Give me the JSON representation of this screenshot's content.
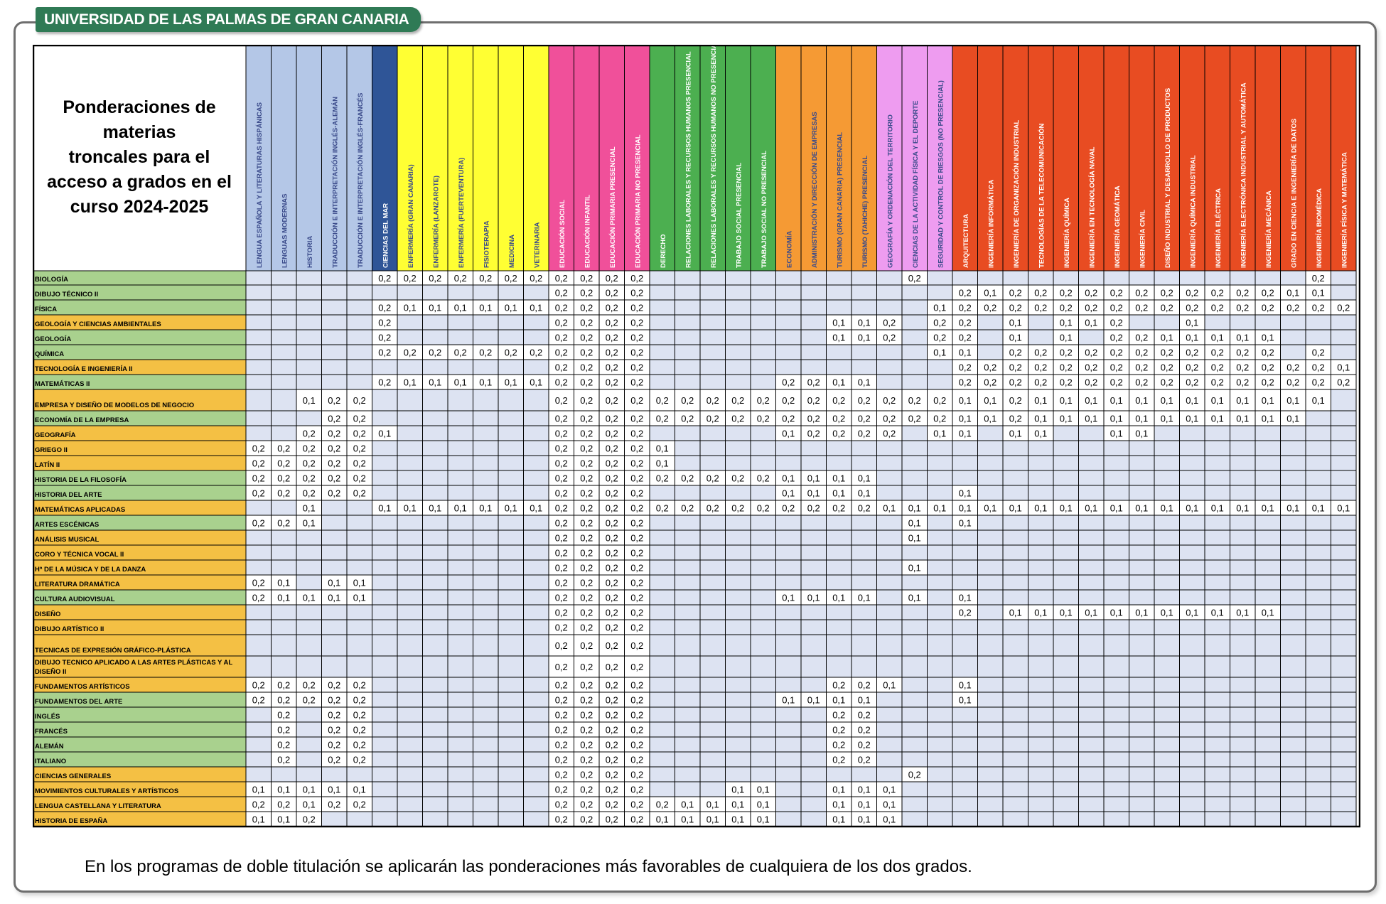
{
  "header": {
    "banner": "UNIVERSIDAD DE LAS PALMAS DE GRAN CANARIA",
    "title_lines": [
      "Ponderaciones de",
      "materias",
      "troncales para el",
      "acceso a grados en el",
      "curso 2024-2025"
    ]
  },
  "footnote": "En los programas de doble titulación se aplicarán las ponderaciones más favorables de cualquiera de los dos grados.",
  "colors": {
    "banner": "#2f7a55",
    "row_green": "#a9d18e",
    "row_orange": "#f4c044",
    "cell_empty": "#dde3f2",
    "cell_filled": "#ffffff",
    "col_blue_light": "#b4c7e7",
    "col_blue_dark": "#2f5597",
    "col_yellow": "#ffff33",
    "col_pink": "#f0509a",
    "col_green": "#4caf50",
    "col_orange": "#f59a34",
    "col_violet": "#ee9cf0",
    "col_red": "#e84c22"
  },
  "degrees": [
    {
      "name": "LENGUA ESPAÑOLA Y LITERATURAS HISPÁNICAS",
      "group": "blue_light"
    },
    {
      "name": "LENGUAS MODERNAS",
      "group": "blue_light"
    },
    {
      "name": "HISTORIA",
      "group": "blue_light"
    },
    {
      "name": "TRADUCCIÓN E INTERPRETACIÓN INGLÉS-ALEMÁN",
      "group": "blue_light"
    },
    {
      "name": "TRADUCCIÓN E INTERPRETACIÓN INGLÉS-FRANCÉS",
      "group": "blue_light"
    },
    {
      "name": "CIENCIAS DEL MAR",
      "group": "blue_dark"
    },
    {
      "name": "ENFERMERÍA (GRAN CANARIA)",
      "group": "yellow"
    },
    {
      "name": "ENFERMERÍA (LANZAROTE)",
      "group": "yellow"
    },
    {
      "name": "ENFERMERÍA (FUERTEVENTURA)",
      "group": "yellow"
    },
    {
      "name": "FISIOTERAPIA",
      "group": "yellow"
    },
    {
      "name": "MEDICINA",
      "group": "yellow"
    },
    {
      "name": "VETERINARIA",
      "group": "yellow"
    },
    {
      "name": "EDUCACIÓN SOCIAL",
      "group": "pink"
    },
    {
      "name": "EDUCACIÓN INFANTIL",
      "group": "pink"
    },
    {
      "name": "EDUCACIÓN PRIMARIA PRESENCIAL",
      "group": "pink"
    },
    {
      "name": "EDUCACIÓN PRIMARIA NO PRESENCIAL",
      "group": "pink"
    },
    {
      "name": "DERECHO",
      "group": "green"
    },
    {
      "name": "RELACIONES LABORALES Y RECURSOS HUMANOS PRESENCIAL",
      "group": "green"
    },
    {
      "name": "RELACIONES LABORALES Y RECURSOS HUMANOS NO PRESENCIAL",
      "group": "green"
    },
    {
      "name": "TRABAJO SOCIAL PRESENCIAL",
      "group": "green"
    },
    {
      "name": "TRABAJO SOCIAL NO PRESENCIAL",
      "group": "green"
    },
    {
      "name": "ECONOMÍA",
      "group": "orange"
    },
    {
      "name": "ADMINISTRACIÓN Y DIRECCIÓN DE EMPRESAS",
      "group": "orange"
    },
    {
      "name": "TURISMO (GRAN CANARIA) PRESENCIAL",
      "group": "orange"
    },
    {
      "name": "TURISMO (TAHICHE) PRESENCIAL",
      "group": "orange"
    },
    {
      "name": "GEOGRAFÍA Y ORDENACIÓN DEL TERRITORIO",
      "group": "violet"
    },
    {
      "name": "CIENCIAS DE LA ACTIVIDAD FÍSICA Y EL DEPORTE",
      "group": "violet"
    },
    {
      "name": "SEGURIDAD Y CONTROL DE RIESGOS (NO PRESENCIAL)",
      "group": "violet"
    },
    {
      "name": "ARQUITECTURA",
      "group": "red"
    },
    {
      "name": "INGENIERÍA INFORMÁTICA",
      "group": "red"
    },
    {
      "name": "INGENIERÍA DE ORGANIZACIÓN INDUSTRIAL",
      "group": "red"
    },
    {
      "name": "TECNOLOGÍAS DE LA TELECOMUNICACIÓN",
      "group": "red"
    },
    {
      "name": "INGENIERÍA QUÍMICA",
      "group": "red"
    },
    {
      "name": "INGENIERÍA EN TECNOLOGÍA NAVAL",
      "group": "red"
    },
    {
      "name": "INGENIERÍA GEOMÁTICA",
      "group": "red"
    },
    {
      "name": "INGENIERÍA CIVIL",
      "group": "red"
    },
    {
      "name": "DISEÑO INDUSTRIAL Y DESARROLLO DE PRODUCTOS",
      "group": "red"
    },
    {
      "name": "INGENIERÍA QUÍMICA INDUSTRIAL",
      "group": "red"
    },
    {
      "name": "INGENIERÍA ELÉCTRICA",
      "group": "red"
    },
    {
      "name": "INGENIERÍA ELECTRÓNICA INDUSTRIAL Y AUTOMÁTICA",
      "group": "red"
    },
    {
      "name": "INGENIERÍA MECÁNICA",
      "group": "red"
    },
    {
      "name": "GRADO EN CIENCIA E INGENIERÍA DE DATOS",
      "group": "red"
    },
    {
      "name": "INGENIERÍA BIOMÉDICA",
      "group": "red"
    },
    {
      "name": "INGENIERÍA FÍSICA Y MATEMÁTICA",
      "group": "red"
    }
  ],
  "rows": [
    {
      "subject": "BIOLOGÍA",
      "group": "green",
      "w": {
        "5": "0,2",
        "6": "0,2",
        "7": "0,2",
        "8": "0,2",
        "9": "0,2",
        "10": "0,2",
        "11": "0,2",
        "12": "0,2",
        "13": "0,2",
        "14": "0,2",
        "15": "0,2",
        "26": "0,2",
        "42": "0,2"
      }
    },
    {
      "subject": "DIBUJO TÉCNICO II",
      "group": "green",
      "w": {
        "12": "0,2",
        "13": "0,2",
        "14": "0,2",
        "15": "0,2",
        "28": "0,2",
        "29": "0,1",
        "30": "0,2",
        "31": "0,2",
        "32": "0,2",
        "33": "0,2",
        "34": "0,2",
        "35": "0,2",
        "36": "0,2",
        "37": "0,2",
        "38": "0,2",
        "39": "0,2",
        "40": "0,2",
        "41": "0,1",
        "42": "0,1"
      }
    },
    {
      "subject": "FÍSICA",
      "group": "green",
      "w": {
        "5": "0,2",
        "6": "0,1",
        "7": "0,1",
        "8": "0,1",
        "9": "0,1",
        "10": "0,1",
        "11": "0,1",
        "12": "0,2",
        "13": "0,2",
        "14": "0,2",
        "15": "0,2",
        "27": "0,1",
        "28": "0,2",
        "29": "0,2",
        "30": "0,2",
        "31": "0,2",
        "32": "0,2",
        "33": "0,2",
        "34": "0,2",
        "35": "0,2",
        "36": "0,2",
        "37": "0,2",
        "38": "0,2",
        "39": "0,2",
        "40": "0,2",
        "41": "0,2",
        "42": "0,2",
        "43": "0,2"
      }
    },
    {
      "subject": "GEOLOGÍA Y CIENCIAS AMBIENTALES",
      "group": "orange",
      "w": {
        "5": "0,2",
        "12": "0,2",
        "13": "0,2",
        "14": "0,2",
        "15": "0,2",
        "23": "0,1",
        "24": "0,1",
        "25": "0,2",
        "27": "0,2",
        "28": "0,2",
        "30": "0,1",
        "32": "0,1",
        "33": "0,1",
        "34": "0,2",
        "37": "0,1"
      }
    },
    {
      "subject": "GEOLOGÍA",
      "group": "green",
      "w": {
        "5": "0,2",
        "12": "0,2",
        "13": "0,2",
        "14": "0,2",
        "15": "0,2",
        "23": "0,1",
        "24": "0,1",
        "25": "0,2",
        "27": "0,2",
        "28": "0,2",
        "30": "0,1",
        "32": "0,1",
        "34": "0,2",
        "35": "0,2",
        "36": "0,1",
        "37": "0,1",
        "38": "0,1",
        "39": "0,1",
        "40": "0,1"
      }
    },
    {
      "subject": "QUÍMICA",
      "group": "green",
      "w": {
        "5": "0,2",
        "6": "0,2",
        "7": "0,2",
        "8": "0,2",
        "9": "0,2",
        "10": "0,2",
        "11": "0,2",
        "12": "0,2",
        "13": "0,2",
        "14": "0,2",
        "15": "0,2",
        "27": "0,1",
        "28": "0,1",
        "30": "0,2",
        "31": "0,2",
        "32": "0,2",
        "33": "0,2",
        "34": "0,2",
        "35": "0,2",
        "36": "0,2",
        "37": "0,2",
        "38": "0,2",
        "39": "0,2",
        "40": "0,2",
        "42": "0,2"
      }
    },
    {
      "subject": "TECNOLOGÍA E INGENIERÍA II",
      "group": "orange",
      "w": {
        "12": "0,2",
        "13": "0,2",
        "14": "0,2",
        "15": "0,2",
        "28": "0,2",
        "29": "0,2",
        "30": "0,2",
        "31": "0,2",
        "32": "0,2",
        "33": "0,2",
        "34": "0,2",
        "35": "0,2",
        "36": "0,2",
        "37": "0,2",
        "38": "0,2",
        "39": "0,2",
        "40": "0,2",
        "41": "0,2",
        "42": "0,2",
        "43": "0,1"
      }
    },
    {
      "subject": "MATEMÁTICAS II",
      "group": "green",
      "w": {
        "5": "0,2",
        "6": "0,1",
        "7": "0,1",
        "8": "0,1",
        "9": "0,1",
        "10": "0,1",
        "11": "0,1",
        "12": "0,2",
        "13": "0,2",
        "14": "0,2",
        "15": "0,2",
        "21": "0,2",
        "22": "0,2",
        "23": "0,1",
        "24": "0,1",
        "28": "0,2",
        "29": "0,2",
        "30": "0,2",
        "31": "0,2",
        "32": "0,2",
        "33": "0,2",
        "34": "0,2",
        "35": "0,2",
        "36": "0,2",
        "37": "0,2",
        "38": "0,2",
        "39": "0,2",
        "40": "0,2",
        "41": "0,2",
        "42": "0,2",
        "43": "0,2"
      }
    },
    {
      "subject": "EMPRESA Y DISEÑO DE MODELOS DE NEGOCIO",
      "group": "orange",
      "w": {
        "2": "0,1",
        "3": "0,2",
        "4": "0,2",
        "12": "0,2",
        "13": "0,2",
        "14": "0,2",
        "15": "0,2",
        "16": "0,2",
        "17": "0,2",
        "18": "0,2",
        "19": "0,2",
        "20": "0,2",
        "21": "0,2",
        "22": "0,2",
        "23": "0,2",
        "24": "0,2",
        "25": "0,2",
        "26": "0,2",
        "27": "0,2",
        "28": "0,1",
        "29": "0,1",
        "30": "0,2",
        "31": "0,1",
        "32": "0,1",
        "33": "0,1",
        "34": "0,1",
        "35": "0,1",
        "36": "0,1",
        "37": "0,1",
        "38": "0,1",
        "39": "0,1",
        "40": "0,1",
        "41": "0,1",
        "42": "0,1"
      }
    },
    {
      "subject": "ECONOMÍA DE LA EMPRESA",
      "group": "green",
      "w": {
        "3": "0,2",
        "4": "0,2",
        "12": "0,2",
        "13": "0,2",
        "14": "0,2",
        "15": "0,2",
        "16": "0,2",
        "17": "0,2",
        "18": "0,2",
        "19": "0,2",
        "20": "0,2",
        "21": "0,2",
        "22": "0,2",
        "23": "0,2",
        "24": "0,2",
        "25": "0,2",
        "26": "0,2",
        "27": "0,2",
        "28": "0,1",
        "29": "0,1",
        "30": "0,2",
        "31": "0,1",
        "32": "0,1",
        "33": "0,1",
        "34": "0,1",
        "35": "0,1",
        "36": "0,1",
        "37": "0,1",
        "38": "0,1",
        "39": "0,1",
        "40": "0,1",
        "41": "0,1"
      }
    },
    {
      "subject": "GEOGRAFÍA",
      "group": "orange",
      "w": {
        "2": "0,2",
        "3": "0,2",
        "4": "0,2",
        "5": "0,1",
        "12": "0,2",
        "13": "0,2",
        "14": "0,2",
        "15": "0,2",
        "21": "0,1",
        "22": "0,2",
        "23": "0,2",
        "24": "0,2",
        "25": "0,2",
        "27": "0,1",
        "28": "0,1",
        "30": "0,1",
        "31": "0,1",
        "34": "0,1",
        "35": "0,1"
      }
    },
    {
      "subject": "GRIEGO II",
      "group": "orange",
      "w": {
        "0": "0,2",
        "1": "0,2",
        "2": "0,2",
        "3": "0,2",
        "4": "0,2",
        "12": "0,2",
        "13": "0,2",
        "14": "0,2",
        "15": "0,2",
        "16": "0,1"
      }
    },
    {
      "subject": "LATÍN II",
      "group": "orange",
      "w": {
        "0": "0,2",
        "1": "0,2",
        "2": "0,2",
        "3": "0,2",
        "4": "0,2",
        "12": "0,2",
        "13": "0,2",
        "14": "0,2",
        "15": "0,2",
        "16": "0,1"
      }
    },
    {
      "subject": "HISTORIA DE LA FILOSOFÍA",
      "group": "green",
      "w": {
        "0": "0,2",
        "1": "0,2",
        "2": "0,2",
        "3": "0,2",
        "4": "0,2",
        "12": "0,2",
        "13": "0,2",
        "14": "0,2",
        "15": "0,2",
        "16": "0,2",
        "17": "0,2",
        "18": "0,2",
        "19": "0,2",
        "20": "0,2",
        "21": "0,1",
        "22": "0,1",
        "23": "0,1",
        "24": "0,1"
      }
    },
    {
      "subject": "HISTORIA DEL ARTE",
      "group": "green",
      "w": {
        "0": "0,2",
        "1": "0,2",
        "2": "0,2",
        "3": "0,2",
        "4": "0,2",
        "12": "0,2",
        "13": "0,2",
        "14": "0,2",
        "15": "0,2",
        "21": "0,1",
        "22": "0,1",
        "23": "0,1",
        "24": "0,1",
        "28": "0,1"
      }
    },
    {
      "subject": "MATEMÁTICAS APLICADAS",
      "group": "orange",
      "w": {
        "2": "0,1",
        "5": "0,1",
        "6": "0,1",
        "7": "0,1",
        "8": "0,1",
        "9": "0,1",
        "10": "0,1",
        "11": "0,1",
        "12": "0,2",
        "13": "0,2",
        "14": "0,2",
        "15": "0,2",
        "16": "0,2",
        "17": "0,2",
        "18": "0,2",
        "19": "0,2",
        "20": "0,2",
        "21": "0,2",
        "22": "0,2",
        "23": "0,2",
        "24": "0,2",
        "25": "0,1",
        "26": "0,1",
        "27": "0,1",
        "28": "0,1",
        "29": "0,1",
        "30": "0,1",
        "31": "0,1",
        "32": "0,1",
        "33": "0,1",
        "34": "0,1",
        "35": "0,1",
        "36": "0,1",
        "37": "0,1",
        "38": "0,1",
        "39": "0,1",
        "40": "0,1",
        "41": "0,1",
        "42": "0,1",
        "43": "0,1"
      }
    },
    {
      "subject": "ARTES ESCÉNICAS",
      "group": "green",
      "w": {
        "0": "0,2",
        "1": "0,2",
        "2": "0,1",
        "12": "0,2",
        "13": "0,2",
        "14": "0,2",
        "15": "0,2",
        "26": "0,1",
        "28": "0,1"
      }
    },
    {
      "subject": "ANÁLISIS MUSICAL",
      "group": "orange",
      "w": {
        "12": "0,2",
        "13": "0,2",
        "14": "0,2",
        "15": "0,2",
        "26": "0,1"
      }
    },
    {
      "subject": "CORO Y TÉCNICA VOCAL II",
      "group": "orange",
      "w": {
        "12": "0,2",
        "13": "0,2",
        "14": "0,2",
        "15": "0,2"
      }
    },
    {
      "subject": "Hª DE LA MÚSICA Y DE LA DANZA",
      "group": "orange",
      "w": {
        "12": "0,2",
        "13": "0,2",
        "14": "0,2",
        "15": "0,2",
        "26": "0,1"
      }
    },
    {
      "subject": "LITERATURA DRAMÁTICA",
      "group": "orange",
      "w": {
        "0": "0,2",
        "1": "0,1",
        "3": "0,1",
        "4": "0,1",
        "12": "0,2",
        "13": "0,2",
        "14": "0,2",
        "15": "0,2"
      }
    },
    {
      "subject": "CULTURA AUDIOVISUAL",
      "group": "green",
      "w": {
        "0": "0,2",
        "1": "0,1",
        "2": "0,1",
        "3": "0,1",
        "4": "0,1",
        "12": "0,2",
        "13": "0,2",
        "14": "0,2",
        "15": "0,2",
        "21": "0,1",
        "22": "0,1",
        "23": "0,1",
        "24": "0,1",
        "26": "0,1",
        "28": "0,1"
      }
    },
    {
      "subject": "DISEÑO",
      "group": "orange",
      "w": {
        "12": "0,2",
        "13": "0,2",
        "14": "0,2",
        "15": "0,2",
        "28": "0,2",
        "30": "0,1",
        "31": "0,1",
        "32": "0,1",
        "33": "0,1",
        "34": "0,1",
        "35": "0,1",
        "36": "0,1",
        "37": "0,1",
        "38": "0,1",
        "39": "0,1",
        "40": "0,1"
      }
    },
    {
      "subject": "DIBUJO ARTÍSTICO II",
      "group": "orange",
      "w": {
        "12": "0,2",
        "13": "0,2",
        "14": "0,2",
        "15": "0,2"
      }
    },
    {
      "subject": "TECNICAS DE EXPRESIÓN GRÁFICO-PLÁSTICA",
      "group": "orange",
      "w": {
        "12": "0,2",
        "13": "0,2",
        "14": "0,2",
        "15": "0,2"
      }
    },
    {
      "subject": "DIBUJO TECNICO APLICADO A LAS ARTES PLÁSTICAS Y AL DISEÑO II",
      "group": "orange",
      "w": {
        "12": "0,2",
        "13": "0,2",
        "14": "0,2",
        "15": "0,2"
      }
    },
    {
      "subject": "FUNDAMENTOS ARTÍSTICOS",
      "group": "orange",
      "w": {
        "0": "0,2",
        "1": "0,2",
        "2": "0,2",
        "3": "0,2",
        "4": "0,2",
        "12": "0,2",
        "13": "0,2",
        "14": "0,2",
        "15": "0,2",
        "23": "0,2",
        "24": "0,2",
        "25": "0,1",
        "28": "0,1"
      }
    },
    {
      "subject": "FUNDAMENTOS DEL ARTE",
      "group": "green",
      "w": {
        "0": "0,2",
        "1": "0,2",
        "2": "0,2",
        "3": "0,2",
        "4": "0,2",
        "12": "0,2",
        "13": "0,2",
        "14": "0,2",
        "15": "0,2",
        "21": "0,1",
        "22": "0,1",
        "23": "0,1",
        "24": "0,1",
        "28": "0,1"
      }
    },
    {
      "subject": "INGLÉS",
      "group": "green",
      "w": {
        "1": "0,2",
        "3": "0,2",
        "4": "0,2",
        "12": "0,2",
        "13": "0,2",
        "14": "0,2",
        "15": "0,2",
        "23": "0,2",
        "24": "0,2"
      }
    },
    {
      "subject": "FRANCÉS",
      "group": "green",
      "w": {
        "1": "0,2",
        "3": "0,2",
        "4": "0,2",
        "12": "0,2",
        "13": "0,2",
        "14": "0,2",
        "15": "0,2",
        "23": "0,2",
        "24": "0,2"
      }
    },
    {
      "subject": "ALEMÁN",
      "group": "green",
      "w": {
        "1": "0,2",
        "3": "0,2",
        "4": "0,2",
        "12": "0,2",
        "13": "0,2",
        "14": "0,2",
        "15": "0,2",
        "23": "0,2",
        "24": "0,2"
      }
    },
    {
      "subject": "ITALIANO",
      "group": "green",
      "w": {
        "1": "0,2",
        "3": "0,2",
        "4": "0,2",
        "12": "0,2",
        "13": "0,2",
        "14": "0,2",
        "15": "0,2",
        "23": "0,2",
        "24": "0,2"
      }
    },
    {
      "subject": "CIENCIAS GENERALES",
      "group": "orange",
      "w": {
        "12": "0,2",
        "13": "0,2",
        "14": "0,2",
        "15": "0,2",
        "26": "0,2"
      }
    },
    {
      "subject": "MOVIMIENTOS CULTURALES Y ARTÍSTICOS",
      "group": "orange",
      "w": {
        "0": "0,1",
        "1": "0,1",
        "2": "0,1",
        "3": "0,1",
        "4": "0,1",
        "12": "0,2",
        "13": "0,2",
        "14": "0,2",
        "15": "0,2",
        "19": "0,1",
        "20": "0,1",
        "23": "0,1",
        "24": "0,1",
        "25": "0,1"
      }
    },
    {
      "subject": "LENGUA CASTELLANA Y LITERATURA",
      "group": "orange",
      "w": {
        "0": "0,2",
        "1": "0,2",
        "2": "0,1",
        "3": "0,2",
        "4": "0,2",
        "12": "0,2",
        "13": "0,2",
        "14": "0,2",
        "15": "0,2",
        "16": "0,2",
        "17": "0,1",
        "18": "0,1",
        "19": "0,1",
        "20": "0,1",
        "23": "0,1",
        "24": "0,1",
        "25": "0,1"
      }
    },
    {
      "subject": "HISTORIA DE ESPAÑA",
      "group": "orange",
      "w": {
        "0": "0,1",
        "1": "0,1",
        "2": "0,2",
        "12": "0,2",
        "13": "0,2",
        "14": "0,2",
        "15": "0,2",
        "16": "0,1",
        "17": "0,1",
        "18": "0,1",
        "19": "0,1",
        "20": "0,1",
        "23": "0,1",
        "24": "0,1",
        "25": "0,1"
      }
    }
  ]
}
